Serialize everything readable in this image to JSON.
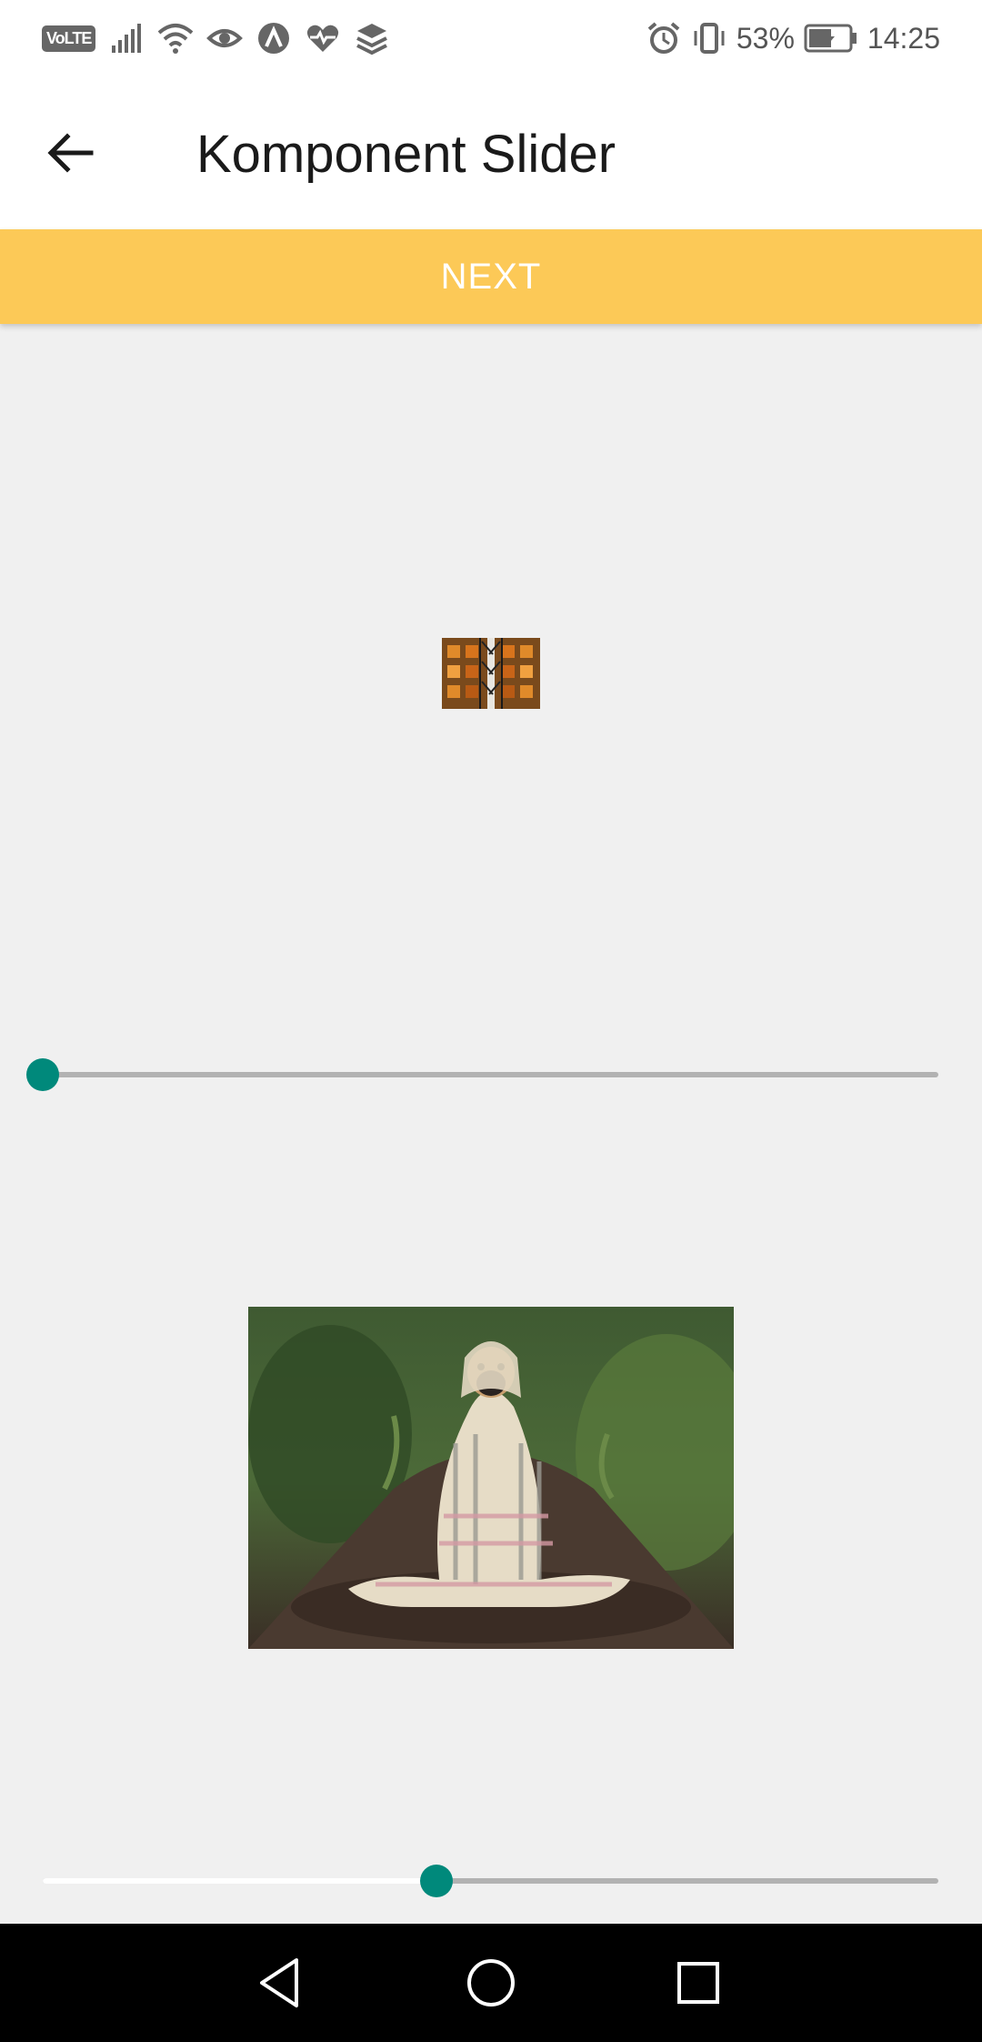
{
  "status_bar": {
    "volte": "VoLTE",
    "battery_percent": "53%",
    "time": "14:25",
    "icons_left": [
      "volte-icon",
      "signal-icon",
      "wifi-icon",
      "eye-icon",
      "app-a-icon",
      "heart-pulse-icon",
      "layers-icon"
    ],
    "icons_right": [
      "alarm-icon",
      "vibrate-icon",
      "battery-charging-icon"
    ]
  },
  "app_bar": {
    "title": "Komponent Slider",
    "back_icon": "arrow-back-icon"
  },
  "next_button": {
    "label": "NEXT",
    "color": "#fcc957"
  },
  "images": {
    "small": "fire-escape-photo",
    "large": "pug-in-blanket-photo"
  },
  "sliders": [
    {
      "name": "top-slider",
      "value": 0.0
    },
    {
      "name": "bottom-slider",
      "value": 0.44
    }
  ],
  "colors": {
    "accent": "#00897b",
    "track": "#b2b2b2",
    "background": "#f0f0f0"
  },
  "nav_bar": {
    "buttons": [
      "nav-back-icon",
      "nav-home-icon",
      "nav-recents-icon"
    ]
  }
}
